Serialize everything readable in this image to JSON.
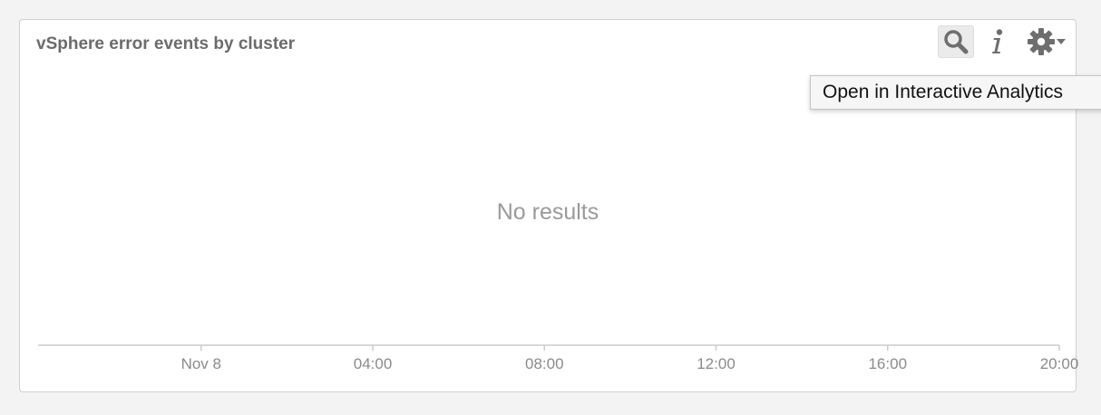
{
  "widget": {
    "title": "vSphere error events by cluster",
    "empty_message": "No results",
    "toolbar": {
      "search_icon": "magnifier",
      "info_icon": "info",
      "gear_icon": "gear-with-dropdown"
    }
  },
  "tooltip": {
    "text": "Open in Interactive Analytics"
  },
  "colors": {
    "title": "#6b6b6b",
    "axis": "#cccccc",
    "icon": "#6e6e6e",
    "empty_text": "#9a9a9a"
  },
  "chart_data": {
    "type": "line",
    "title": "vSphere error events by cluster",
    "series": [],
    "x_tick_labels": [
      "Nov 8",
      "04:00",
      "08:00",
      "12:00",
      "16:00",
      "20:00"
    ],
    "x_tick_hours": [
      0,
      4,
      8,
      12,
      16,
      20
    ],
    "xlim_hours": [
      -3.8,
      20
    ],
    "annotation": "No results"
  }
}
